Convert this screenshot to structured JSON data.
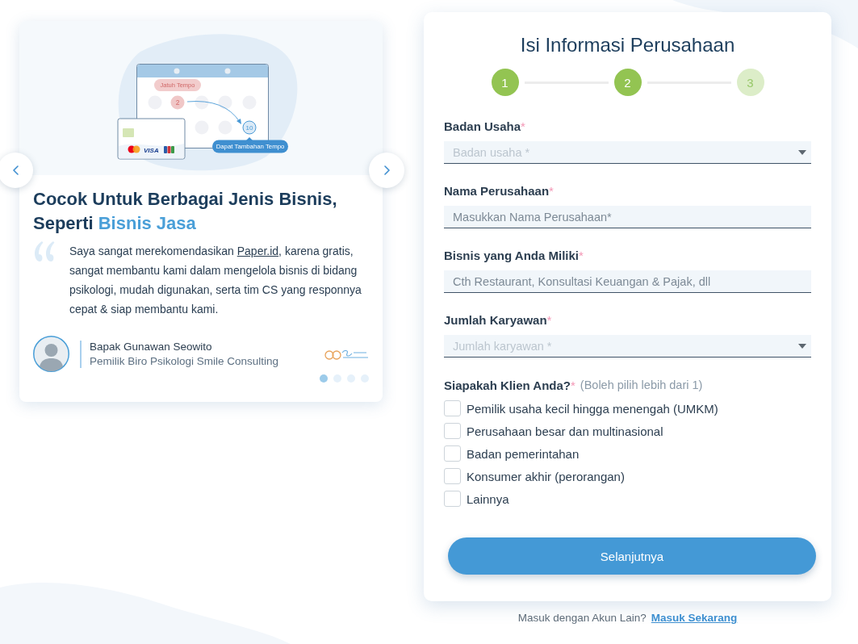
{
  "slide": {
    "illustration": {
      "due_label": "Jatuh Tempo",
      "due_day": "2",
      "new_day": "10",
      "extension_label": "Dapat Tambahan Tempo",
      "card_brand": "VISA"
    },
    "heading": {
      "text": "Cocok Untuk Berbagai Jenis Bisnis, Seperti",
      "highlight": "Bisnis Jasa"
    },
    "quote": {
      "before": "Saya sangat merekomendasikan ",
      "link": "Paper.id",
      "after": ", karena gratis, sangat membantu kami dalam mengelola bisnis di bidang psikologi, mudah digunakan, serta tim CS yang responnya cepat & siap membantu kami."
    },
    "author": {
      "name": "Bapak Gunawan Seowito",
      "role": "Pemilik Biro Psikologi Smile Consulting"
    }
  },
  "carousel_dots": [
    {
      "selected": true
    },
    {
      "selected": false
    },
    {
      "selected": false
    },
    {
      "selected": false
    }
  ],
  "form": {
    "title": "Isi Informasi Perusahaan",
    "steps": [
      {
        "label": "1",
        "reached": true
      },
      {
        "label": "2",
        "reached": true
      },
      {
        "label": "3",
        "reached": false
      }
    ],
    "fields": [
      {
        "kind": "select",
        "label": "Badan Usaha",
        "mark": "*",
        "placeholder": "Badan usaha *"
      },
      {
        "kind": "text",
        "label": "Nama Perusahaan",
        "mark": "*",
        "placeholder": "Masukkan Nama Perusahaan*"
      },
      {
        "kind": "text",
        "label": "Bisnis yang Anda Miliki",
        "mark": "*",
        "placeholder": "Cth Restaurant, Konsultasi Keuangan & Pajak, dll"
      },
      {
        "kind": "select",
        "label": "Jumlah Karyawan",
        "mark": "*",
        "placeholder": "Jumlah karyawan *"
      }
    ],
    "clients": {
      "label": "Siapakah Klien Anda?",
      "mark": "*",
      "hint": "(Boleh pilih lebih dari 1)",
      "options": [
        {
          "label": "Pemilik usaha kecil hingga menengah (UMKM)",
          "checked": false
        },
        {
          "label": "Perusahaan besar dan multinasional",
          "checked": false
        },
        {
          "label": "Badan pemerintahan",
          "checked": false
        },
        {
          "label": "Konsumer akhir (perorangan)",
          "checked": false
        },
        {
          "label": "Lainnya",
          "checked": false
        }
      ]
    },
    "submit": "Selanjutnya"
  },
  "footer": {
    "text": "Masuk dengan Akun Lain?",
    "link": "Masuk Sekarang"
  }
}
